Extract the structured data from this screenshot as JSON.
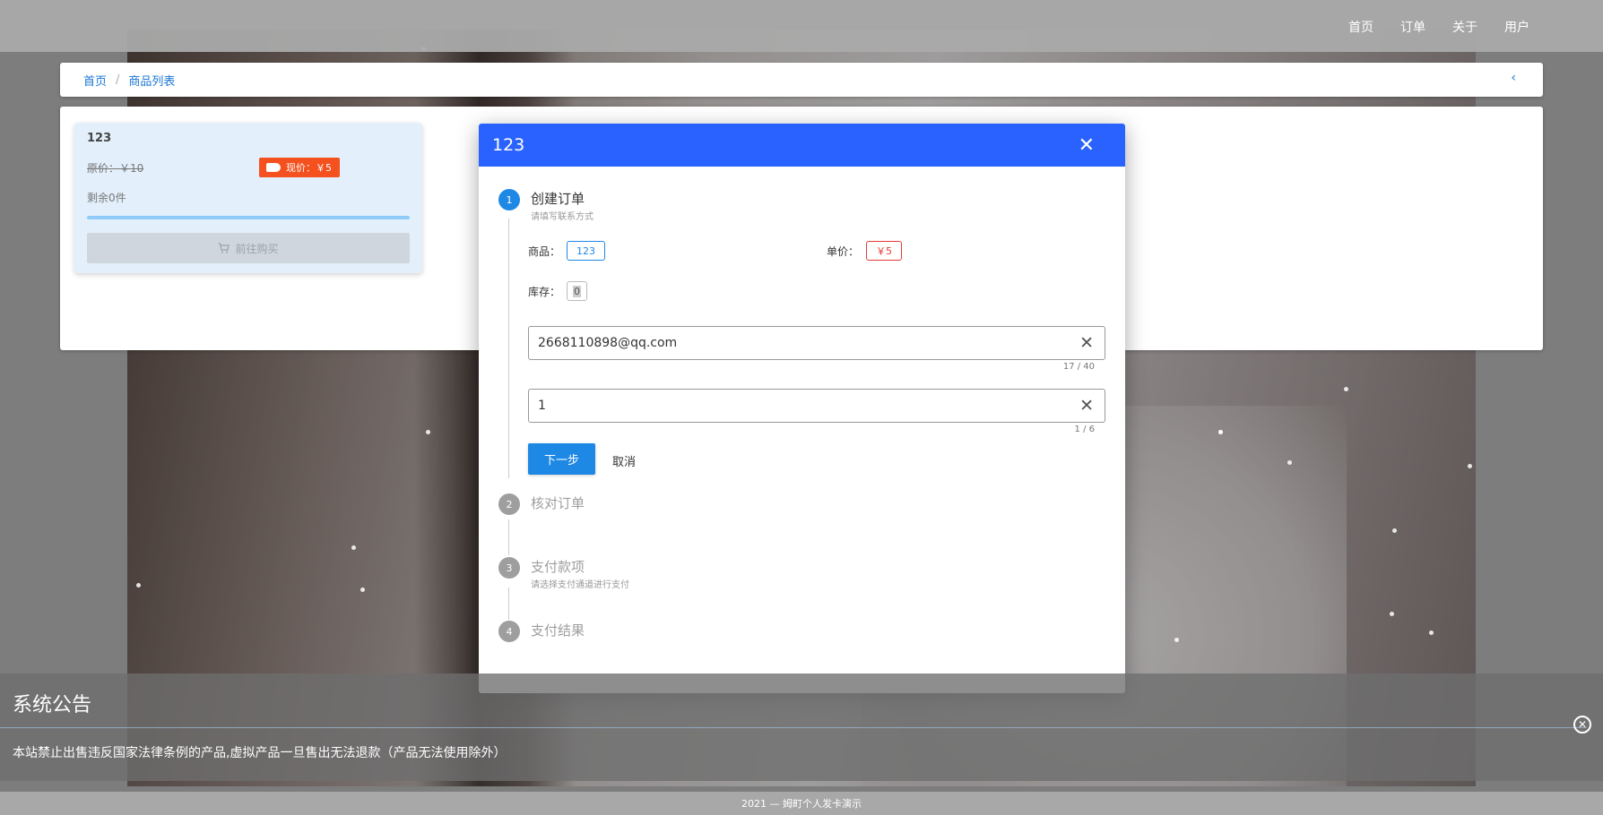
{
  "nav": {
    "links": [
      "首页",
      "订单",
      "关于",
      "用户"
    ]
  },
  "breadcrumb": {
    "items": [
      "首页",
      "商品列表"
    ],
    "separator": "/",
    "back_icon": "‹"
  },
  "product_card": {
    "name": "123",
    "original_price": "原价：￥10",
    "current_price": "现价：￥5",
    "remaining": "剩余0件",
    "buy_label": "前往购买"
  },
  "dialog": {
    "title": "123",
    "close_icon": "✕",
    "steps": [
      {
        "num": "1",
        "title": "创建订单",
        "sub": "请填写联系方式"
      },
      {
        "num": "2",
        "title": "核对订单",
        "sub": ""
      },
      {
        "num": "3",
        "title": "支付款项",
        "sub": "请选择支付通道进行支付"
      },
      {
        "num": "4",
        "title": "支付结果",
        "sub": ""
      }
    ],
    "fields": {
      "product_label": "商品：",
      "product_value": "123",
      "price_label": "单价：",
      "price_value": "￥5",
      "stock_label": "库存：",
      "stock_value": "0"
    },
    "email_input": {
      "value": "2668110898@qq.com",
      "counter": "17 / 40"
    },
    "qty_input": {
      "value": "1",
      "counter": "1 / 6"
    },
    "next_label": "下一步",
    "cancel_label": "取消"
  },
  "notice": {
    "title": "系统公告",
    "text": "本站禁止出售违反国家法律条例的产品,虚拟产品一旦售出无法退款（产品无法使用除外）",
    "close_icon": "✕"
  },
  "footer": {
    "text": "2021 — 姆町个人发卡演示"
  }
}
